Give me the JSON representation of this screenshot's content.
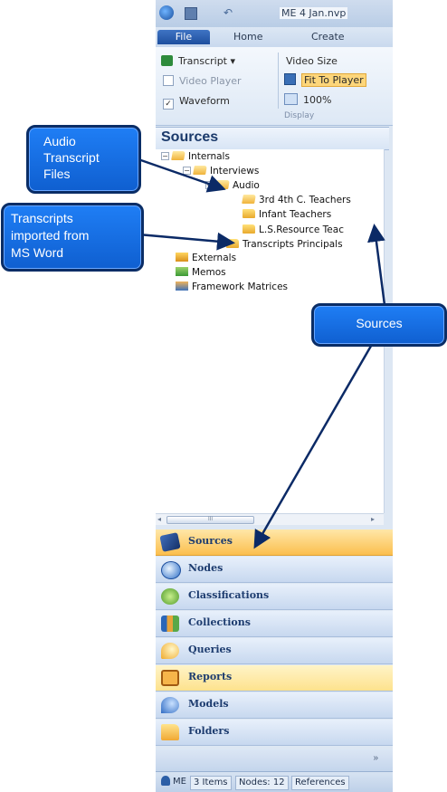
{
  "window": {
    "title": "ME 4 Jan.nvp"
  },
  "ribbon": {
    "tabs": [
      "File",
      "Home",
      "Create"
    ],
    "transcript_label": "Transcript",
    "video_player_label": "Video Player",
    "waveform_label": "Waveform",
    "video_size_label": "Video Size",
    "fit_to_player_label": "Fit To Player",
    "zoom_label": "100%",
    "group_label": "Display"
  },
  "sources_panel": {
    "title": "Sources",
    "tree": {
      "internals": "Internals",
      "interviews": "Interviews",
      "audio": "Audio",
      "audio_children": [
        "3rd 4th C. Teachers",
        "Infant Teachers",
        "L.S.Resource Teac"
      ],
      "transcripts": "Transcripts Principals",
      "externals": "Externals",
      "memos": "Memos",
      "framework": "Framework Matrices"
    },
    "scroll_thumb": "III"
  },
  "navigation": {
    "items": [
      "Sources",
      "Nodes",
      "Classifications",
      "Collections",
      "Queries",
      "Reports",
      "Models",
      "Folders"
    ],
    "active": "Sources",
    "more_glyph": "»"
  },
  "status_bar": {
    "user": "ME",
    "items": "3 Items",
    "nodes": "Nodes: 12",
    "references": "References"
  },
  "callouts": {
    "audio": "Audio\nTranscript\nFiles",
    "transcripts": "Transcripts\nimported from\nMS Word",
    "sources": "Sources"
  },
  "colors": {
    "callout_fill": "#1a72e8",
    "callout_border": "#0a2d66",
    "active_nav": "#fbbf4e"
  }
}
